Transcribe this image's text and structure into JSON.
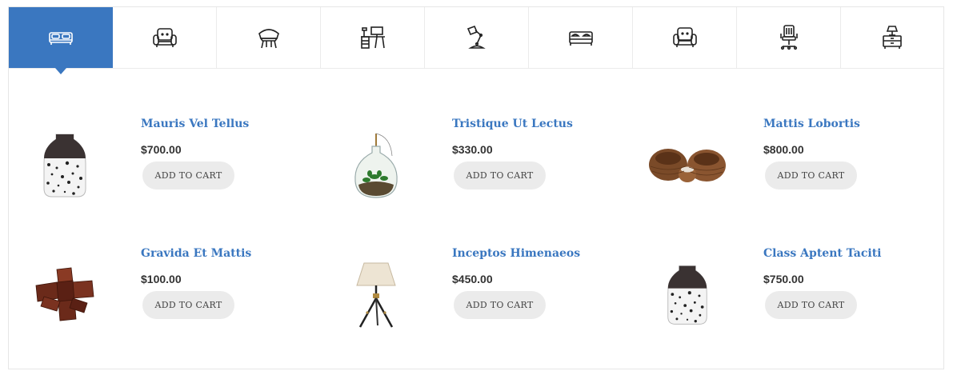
{
  "categories": [
    {
      "icon": "bed-icon",
      "active": true
    },
    {
      "icon": "armchair-icon",
      "active": false
    },
    {
      "icon": "chair-icon",
      "active": false
    },
    {
      "icon": "desk-icon",
      "active": false
    },
    {
      "icon": "desk-lamp-icon",
      "active": false
    },
    {
      "icon": "double-bed-icon",
      "active": false
    },
    {
      "icon": "sofa-chair-icon",
      "active": false
    },
    {
      "icon": "office-chair-icon",
      "active": false
    },
    {
      "icon": "nightstand-lamp-icon",
      "active": false
    }
  ],
  "colors": {
    "accent": "#3a77c0",
    "button_bg": "#ebebeb",
    "price": "#333333"
  },
  "products": [
    {
      "name": "Mauris Vel Tellus",
      "price": "$700.00",
      "button": "ADD TO CART",
      "image": "speckled-vase"
    },
    {
      "name": "Tristique Ut Lectus",
      "price": "$330.00",
      "button": "ADD TO CART",
      "image": "glass-terrarium"
    },
    {
      "name": "Mattis Lobortis",
      "price": "$800.00",
      "button": "ADD TO CART",
      "image": "wicker-baskets"
    },
    {
      "name": "Gravida Et Mattis",
      "price": "$100.00",
      "button": "ADD TO CART",
      "image": "wooden-puzzle"
    },
    {
      "name": "Inceptos Himenaeos",
      "price": "$450.00",
      "button": "ADD TO CART",
      "image": "tripod-lamp"
    },
    {
      "name": "Class Aptent Taciti",
      "price": "$750.00",
      "button": "ADD TO CART",
      "image": "speckled-vase"
    }
  ]
}
